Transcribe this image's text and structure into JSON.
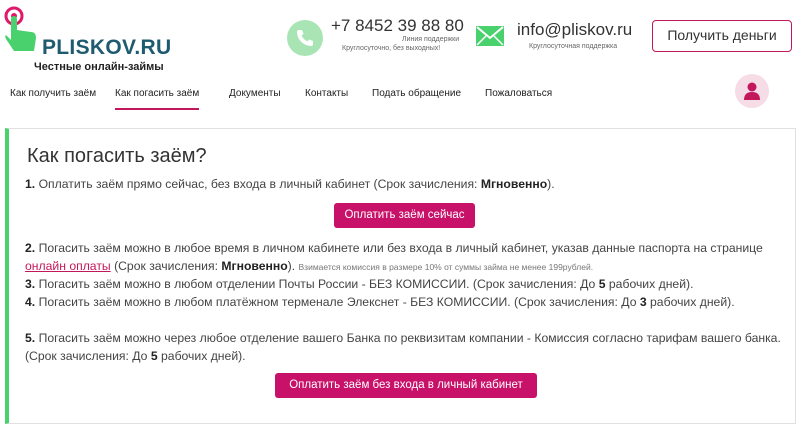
{
  "logo": {
    "title": "PLISKOV.RU",
    "subtitle": "Честные онлайн-займы"
  },
  "phone": {
    "number": "+7 8452 39 88 80",
    "line": "Линия поддержки",
    "hours": "Круглосуточно, без выходных!"
  },
  "mail": {
    "address": "info@pliskov.ru",
    "support": "Круглосуточная поддержка"
  },
  "header_button": "Получить деньги",
  "nav": [
    {
      "label": "Как получить заём",
      "active": false
    },
    {
      "label": "Как погасить заём",
      "active": true
    },
    {
      "label": "Документы",
      "active": false
    },
    {
      "label": "Контакты",
      "active": false
    },
    {
      "label": "Подать обращение",
      "active": false
    },
    {
      "label": "Пожаловаться",
      "active": false
    }
  ],
  "content": {
    "title": "Как погасить заём?",
    "p1": {
      "num": "1.",
      "text": "Оплатить заём прямо сейчас, без входа в личный кабинет (Срок зачисления:",
      "term": "Мгновенно",
      "end": ")."
    },
    "btn1": "Оплатить заём сейчас",
    "p2": {
      "num": "2.",
      "text_a": "Погасить заём можно в любое время в личном кабинете или без входа в личный кабинет, указав данные паспорта на странице",
      "link": "онлайн оплаты",
      "text_b": "(Срок зачисления:",
      "term": "Мгновенно",
      "end": ").",
      "note": "Взимается комиссия в размере 10% от суммы займа не менее 199рублей."
    },
    "p3": {
      "num": "3.",
      "text": "Погасить заём можно в любом отделении Почты России - БЕЗ КОМИССИИ. (Срок зачисления: До",
      "days": "5",
      "end": "рабочих дней)."
    },
    "p4": {
      "num": "4.",
      "text": "Погасить заём можно в любом платёжном терменале Элекснет - БЕЗ КОМИССИИ.  (Срок зачисления: До",
      "days": "3",
      "end": "рабочих дней)."
    },
    "p5": {
      "num": "5.",
      "text": "Погасить заём можно через любое отделение вашего Банка по реквизитам компании - Комиссия согласно тарифам вашего банка.  (Срок зачисления: До",
      "days": "5",
      "end": "рабочих дней)."
    },
    "btn2": "Оплатить заём без входа в личный кабинет"
  },
  "colors": {
    "accent": "#c8126a",
    "green": "#48d16c",
    "logo_text": "#1e5b70"
  },
  "icons": {
    "logo": "pointing-hand-icon",
    "phone": "phone-icon",
    "mail": "envelope-icon",
    "avatar": "user-icon"
  }
}
